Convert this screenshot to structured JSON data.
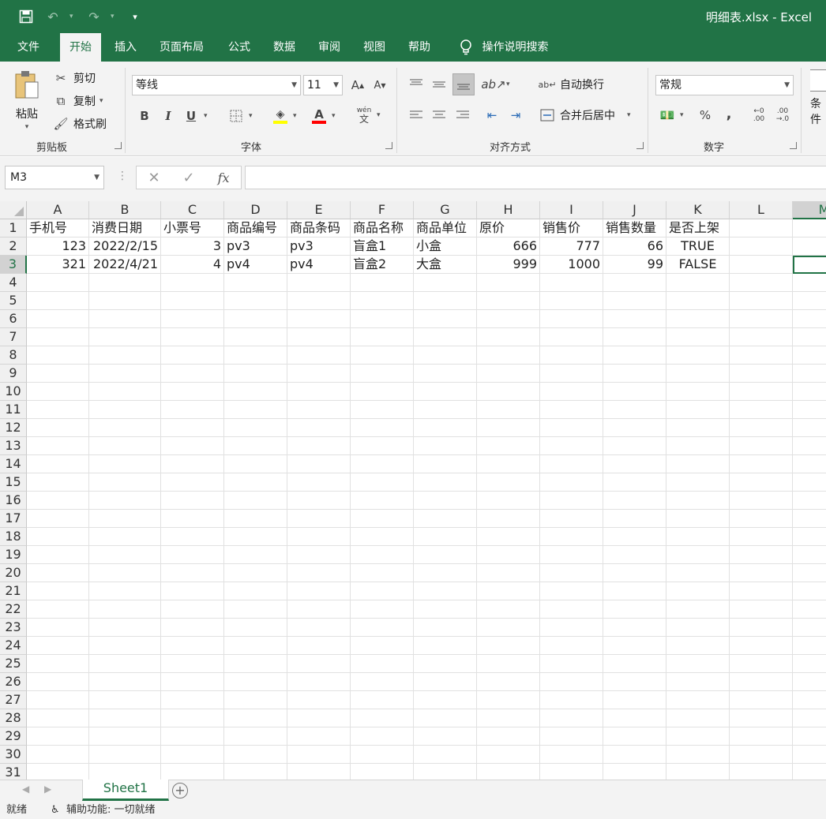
{
  "window": {
    "title": "明细表.xlsx  -  Excel",
    "brand_color": "#217346",
    "qat_icons": [
      "save-icon",
      "undo-icon",
      "redo-icon",
      "customize-qat-icon"
    ]
  },
  "tabs": [
    "文件",
    "开始",
    "插入",
    "页面布局",
    "公式",
    "数据",
    "审阅",
    "视图",
    "帮助"
  ],
  "active_tab": "开始",
  "tell_me": "操作说明搜索",
  "ribbon": {
    "clipboard": {
      "label": "剪贴板",
      "paste": "粘贴",
      "cut": "剪切",
      "copy": "复制",
      "format_painter": "格式刷"
    },
    "font": {
      "label": "字体",
      "name": "等线",
      "size": "11",
      "bold": "B",
      "italic": "I",
      "underline": "U",
      "phonetic_top": "wén",
      "phonetic_bottom": "文",
      "highlight_color": "#ffff00",
      "font_color": "#ff0000"
    },
    "alignment": {
      "label": "对齐方式",
      "wrap": "自动换行",
      "merge": "合并后居中"
    },
    "number": {
      "label": "数字",
      "format": "常规",
      "percent": "%",
      "comma": ",",
      "inc_top": "←0",
      "inc_bottom": ".00",
      "dec_top": ".00",
      "dec_bottom": "→.0"
    },
    "styles_partial": "条件"
  },
  "formula_bar": {
    "name_box": "M3",
    "fx": "fx",
    "cancel": "✕",
    "enter": "✓",
    "content": ""
  },
  "sheet": {
    "columns": [
      "A",
      "B",
      "C",
      "D",
      "E",
      "F",
      "G",
      "H",
      "I",
      "J",
      "K",
      "L",
      "M"
    ],
    "selected_column": "M",
    "rows": [
      "1",
      "2",
      "3",
      "4",
      "5",
      "6",
      "7",
      "8",
      "9",
      "10",
      "11",
      "12",
      "13",
      "14",
      "15",
      "16",
      "17",
      "18",
      "19",
      "20",
      "21",
      "22",
      "23",
      "24",
      "25",
      "26",
      "27",
      "28",
      "29",
      "30",
      "31"
    ],
    "selected_row": "3",
    "header": [
      "手机号",
      "消费日期",
      "小票号",
      "商品编号",
      "商品条码",
      "商品名称",
      "商品单位",
      "原价",
      "销售价",
      "销售数量",
      "是否上架"
    ],
    "data": [
      [
        "123",
        "2022/2/15",
        "3",
        "pv3",
        "pv3",
        "盲盒1",
        "小盒",
        "666",
        "777",
        "66",
        "TRUE"
      ],
      [
        "321",
        "2022/4/21",
        "4",
        "pv4",
        "pv4",
        "盲盒2",
        "大盒",
        "999",
        "1000",
        "99",
        "FALSE"
      ]
    ],
    "active_cell": "M3"
  },
  "sheet_tabs": [
    "Sheet1"
  ],
  "status": {
    "ready": "就绪",
    "accessibility": "辅助功能: 一切就绪"
  }
}
